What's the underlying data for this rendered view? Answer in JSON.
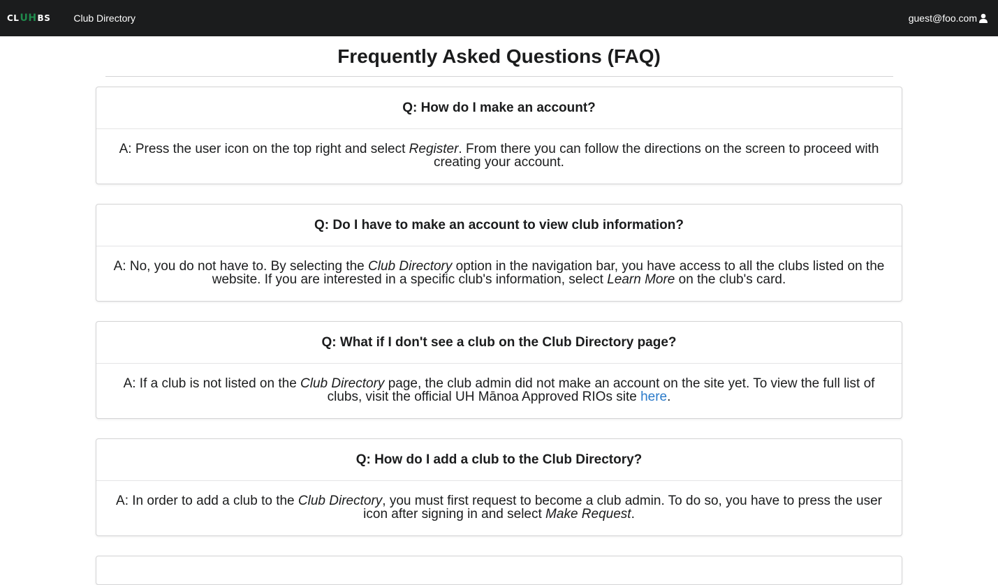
{
  "navbar": {
    "logo": {
      "left": "CL",
      "mid": "UH",
      "right": "BS"
    },
    "club_directory_label": "Club Directory",
    "user_email": "guest@foo.com",
    "user_icon": "user-icon"
  },
  "page": {
    "title": "Frequently Asked Questions (FAQ)"
  },
  "faqs": [
    {
      "question": "Q: How do I make an account?",
      "answer": {
        "p1": "A: Press the user icon on the top right and select ",
        "em1": "Register",
        "p2": ". From there you can follow the directions on the screen to proceed with creating your account."
      }
    },
    {
      "question": "Q: Do I have to make an account to view club information?",
      "answer": {
        "p1": "A: No, you do not have to. By selecting the ",
        "em1": "Club Directory",
        "p2": " option in the navigation bar, you have access to all the clubs listed on the website. If you are interested in a specific club's information, select ",
        "em2": "Learn More",
        "p3": " on the club's card."
      }
    },
    {
      "question": "Q: What if I don't see a club on the Club Directory page?",
      "answer": {
        "p1": "A: If a club is not listed on the ",
        "em1": "Club Directory",
        "p2": " page, the club admin did not make an account on the site yet. To view the full list of clubs, visit the official UH Mānoa Approved RIOs site ",
        "link": "here",
        "p3": "."
      }
    },
    {
      "question": "Q: How do I add a club to the Club Directory?",
      "answer": {
        "p1": "A: In order to add a club to the ",
        "em1": "Club Directory",
        "p2": ", you must first request to become a club admin. To do so, you have to press the user icon after signing in and select ",
        "em2": "Make Request",
        "p3": "."
      }
    }
  ]
}
